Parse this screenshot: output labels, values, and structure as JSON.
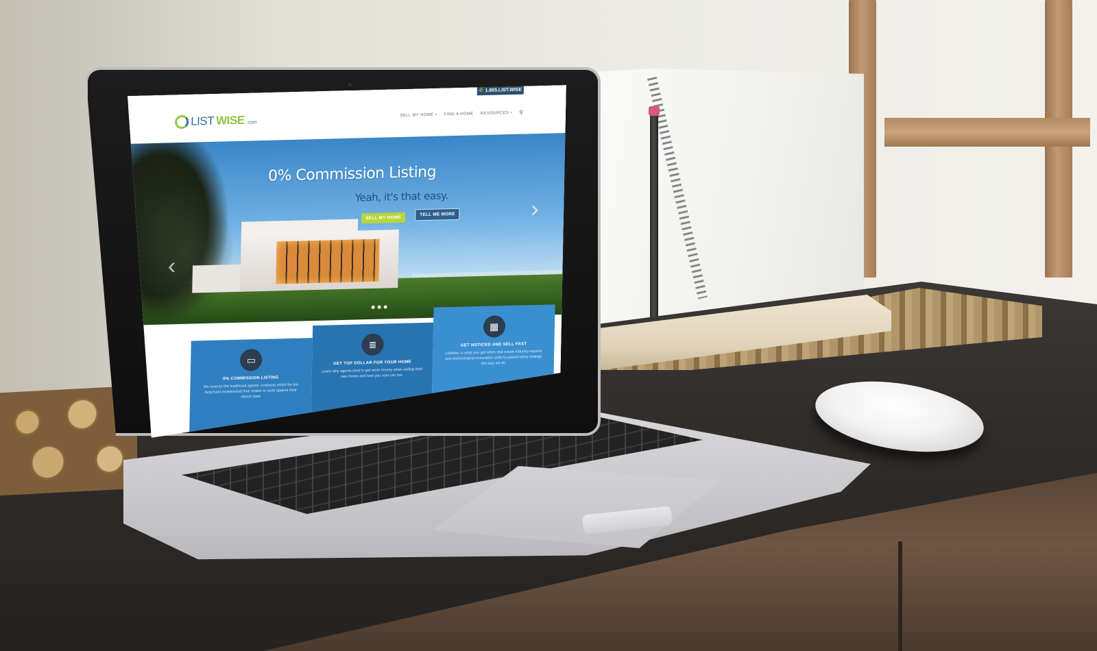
{
  "site": {
    "phone": "1.855.LIST.WISE",
    "logo": {
      "part1": "LIST",
      "part2": "WISE",
      "suffix": ".com"
    },
    "nav": [
      {
        "label": "SELL MY HOME",
        "has_dropdown": true
      },
      {
        "label": "FIND A HOME",
        "has_dropdown": false
      },
      {
        "label": "RESOURCES",
        "has_dropdown": true
      }
    ],
    "hero": {
      "title": "0% Commission Listing",
      "subtitle": "Yeah, it's that easy.",
      "primary_button": "SELL MY HOME",
      "secondary_button": "TELL ME MORE",
      "slides": 3
    },
    "features": [
      {
        "icon": "monitor-icon",
        "title": "0% COMMISSION LISTING",
        "text": "We reverse the traditional agents' contracts which for too long have incentivized their realtor to work against their client's best"
      },
      {
        "icon": "coins-icon",
        "title": "GET TOP DOLLAR FOR YOUR HOME",
        "text": "Learn why agents tend to get more money when selling their own home and how you now can too."
      },
      {
        "icon": "chart-icon",
        "title": "GET NOTICED AND SELL FAST",
        "text": "ListWise is what you get when real estate industry experts and technological innovators unite to passionately change the way we do"
      }
    ],
    "colors": {
      "brand_blue": "#2e6fa3",
      "brand_green": "#8fc63f",
      "navy": "#2e4d6b"
    }
  }
}
